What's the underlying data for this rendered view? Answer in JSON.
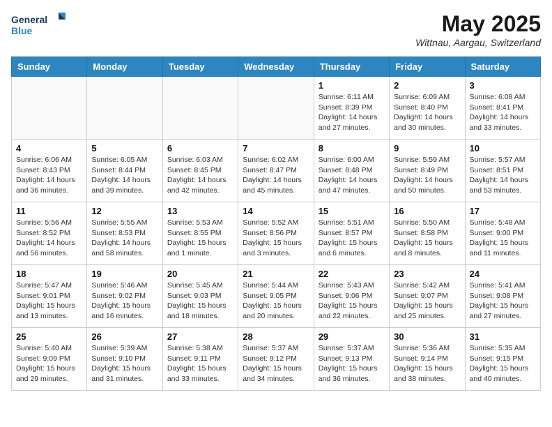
{
  "header": {
    "logo_line1": "General",
    "logo_line2": "Blue",
    "month_title": "May 2025",
    "location": "Wittnau, Aargau, Switzerland"
  },
  "weekdays": [
    "Sunday",
    "Monday",
    "Tuesday",
    "Wednesday",
    "Thursday",
    "Friday",
    "Saturday"
  ],
  "weeks": [
    [
      {
        "day": "",
        "info": ""
      },
      {
        "day": "",
        "info": ""
      },
      {
        "day": "",
        "info": ""
      },
      {
        "day": "",
        "info": ""
      },
      {
        "day": "1",
        "info": "Sunrise: 6:11 AM\nSunset: 8:39 PM\nDaylight: 14 hours\nand 27 minutes."
      },
      {
        "day": "2",
        "info": "Sunrise: 6:09 AM\nSunset: 8:40 PM\nDaylight: 14 hours\nand 30 minutes."
      },
      {
        "day": "3",
        "info": "Sunrise: 6:08 AM\nSunset: 8:41 PM\nDaylight: 14 hours\nand 33 minutes."
      }
    ],
    [
      {
        "day": "4",
        "info": "Sunrise: 6:06 AM\nSunset: 8:43 PM\nDaylight: 14 hours\nand 36 minutes."
      },
      {
        "day": "5",
        "info": "Sunrise: 6:05 AM\nSunset: 8:44 PM\nDaylight: 14 hours\nand 39 minutes."
      },
      {
        "day": "6",
        "info": "Sunrise: 6:03 AM\nSunset: 8:45 PM\nDaylight: 14 hours\nand 42 minutes."
      },
      {
        "day": "7",
        "info": "Sunrise: 6:02 AM\nSunset: 8:47 PM\nDaylight: 14 hours\nand 45 minutes."
      },
      {
        "day": "8",
        "info": "Sunrise: 6:00 AM\nSunset: 8:48 PM\nDaylight: 14 hours\nand 47 minutes."
      },
      {
        "day": "9",
        "info": "Sunrise: 5:59 AM\nSunset: 8:49 PM\nDaylight: 14 hours\nand 50 minutes."
      },
      {
        "day": "10",
        "info": "Sunrise: 5:57 AM\nSunset: 8:51 PM\nDaylight: 14 hours\nand 53 minutes."
      }
    ],
    [
      {
        "day": "11",
        "info": "Sunrise: 5:56 AM\nSunset: 8:52 PM\nDaylight: 14 hours\nand 56 minutes."
      },
      {
        "day": "12",
        "info": "Sunrise: 5:55 AM\nSunset: 8:53 PM\nDaylight: 14 hours\nand 58 minutes."
      },
      {
        "day": "13",
        "info": "Sunrise: 5:53 AM\nSunset: 8:55 PM\nDaylight: 15 hours\nand 1 minute."
      },
      {
        "day": "14",
        "info": "Sunrise: 5:52 AM\nSunset: 8:56 PM\nDaylight: 15 hours\nand 3 minutes."
      },
      {
        "day": "15",
        "info": "Sunrise: 5:51 AM\nSunset: 8:57 PM\nDaylight: 15 hours\nand 6 minutes."
      },
      {
        "day": "16",
        "info": "Sunrise: 5:50 AM\nSunset: 8:58 PM\nDaylight: 15 hours\nand 8 minutes."
      },
      {
        "day": "17",
        "info": "Sunrise: 5:48 AM\nSunset: 9:00 PM\nDaylight: 15 hours\nand 11 minutes."
      }
    ],
    [
      {
        "day": "18",
        "info": "Sunrise: 5:47 AM\nSunset: 9:01 PM\nDaylight: 15 hours\nand 13 minutes."
      },
      {
        "day": "19",
        "info": "Sunrise: 5:46 AM\nSunset: 9:02 PM\nDaylight: 15 hours\nand 16 minutes."
      },
      {
        "day": "20",
        "info": "Sunrise: 5:45 AM\nSunset: 9:03 PM\nDaylight: 15 hours\nand 18 minutes."
      },
      {
        "day": "21",
        "info": "Sunrise: 5:44 AM\nSunset: 9:05 PM\nDaylight: 15 hours\nand 20 minutes."
      },
      {
        "day": "22",
        "info": "Sunrise: 5:43 AM\nSunset: 9:06 PM\nDaylight: 15 hours\nand 22 minutes."
      },
      {
        "day": "23",
        "info": "Sunrise: 5:42 AM\nSunset: 9:07 PM\nDaylight: 15 hours\nand 25 minutes."
      },
      {
        "day": "24",
        "info": "Sunrise: 5:41 AM\nSunset: 9:08 PM\nDaylight: 15 hours\nand 27 minutes."
      }
    ],
    [
      {
        "day": "25",
        "info": "Sunrise: 5:40 AM\nSunset: 9:09 PM\nDaylight: 15 hours\nand 29 minutes."
      },
      {
        "day": "26",
        "info": "Sunrise: 5:39 AM\nSunset: 9:10 PM\nDaylight: 15 hours\nand 31 minutes."
      },
      {
        "day": "27",
        "info": "Sunrise: 5:38 AM\nSunset: 9:11 PM\nDaylight: 15 hours\nand 33 minutes."
      },
      {
        "day": "28",
        "info": "Sunrise: 5:37 AM\nSunset: 9:12 PM\nDaylight: 15 hours\nand 34 minutes."
      },
      {
        "day": "29",
        "info": "Sunrise: 5:37 AM\nSunset: 9:13 PM\nDaylight: 15 hours\nand 36 minutes."
      },
      {
        "day": "30",
        "info": "Sunrise: 5:36 AM\nSunset: 9:14 PM\nDaylight: 15 hours\nand 38 minutes."
      },
      {
        "day": "31",
        "info": "Sunrise: 5:35 AM\nSunset: 9:15 PM\nDaylight: 15 hours\nand 40 minutes."
      }
    ]
  ]
}
